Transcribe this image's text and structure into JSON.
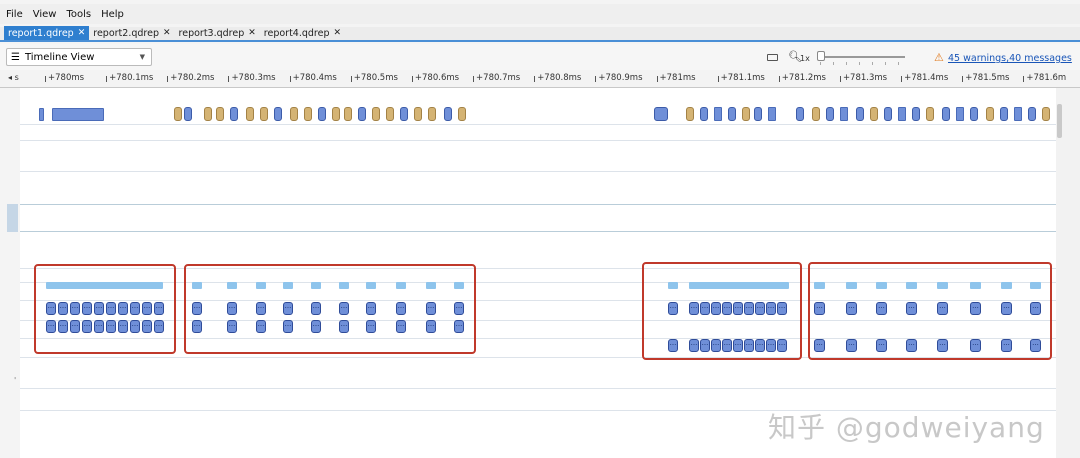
{
  "menu": [
    {
      "label": "File"
    },
    {
      "label": "View"
    },
    {
      "label": "Tools"
    },
    {
      "label": "Help"
    }
  ],
  "tabs": [
    {
      "label": "report1.qdrep",
      "active": true
    },
    {
      "label": "report2.qdrep",
      "active": false
    },
    {
      "label": "report3.qdrep",
      "active": false
    },
    {
      "label": "report4.qdrep",
      "active": false
    }
  ],
  "toolbar": {
    "view_select": "Timeline View",
    "zoom_label": "1x",
    "warnings_link": "45 warnings,40 messages"
  },
  "ruler": {
    "start_label": "s",
    "ticks": [
      "+780ms",
      "+780.1ms",
      "+780.2ms",
      "+780.3ms",
      "+780.4ms",
      "+780.5ms",
      "+780.6ms",
      "+780.7ms",
      "+780.8ms",
      "+780.9ms",
      "+781ms",
      "+781.1ms",
      "+781.2ms",
      "+781.3ms",
      "+781.4ms",
      "+781.5ms",
      "+781.6m"
    ]
  },
  "timeline": {
    "kernel_label": "...",
    "highlight_boxes": 4
  },
  "watermark": "知乎 @godweiyang",
  "colors": {
    "accent": "#2f7fcf",
    "kernel_blue": "#6f8fd8",
    "kernel_tan": "#d4b373",
    "memcpy_lightblue": "#8ec4ec",
    "highlight_red": "#c0392b",
    "warning_orange": "#e07a1f",
    "link_blue": "#1a56b8"
  }
}
